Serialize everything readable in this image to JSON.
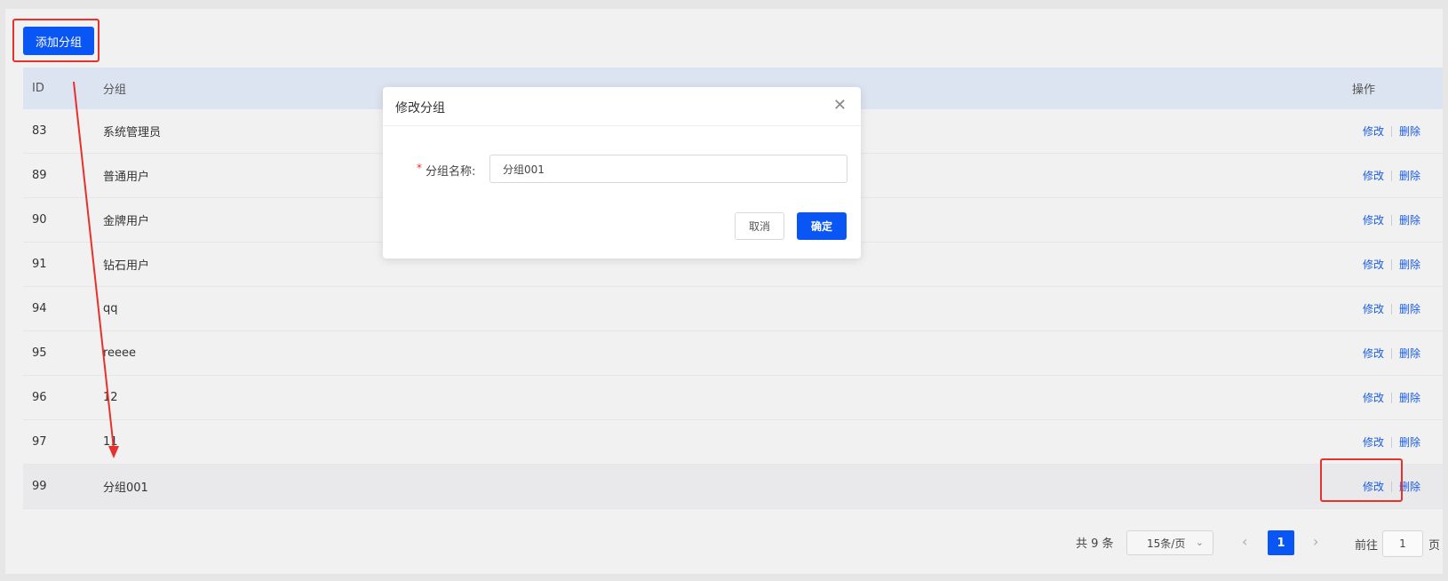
{
  "toolbar": {
    "add_group_label": "添加分组"
  },
  "table": {
    "headers": {
      "id": "ID",
      "name": "分组",
      "ops": "操作"
    },
    "rows": [
      {
        "id": "83",
        "name": "系统管理员"
      },
      {
        "id": "89",
        "name": "普通用户"
      },
      {
        "id": "90",
        "name": "金牌用户"
      },
      {
        "id": "91",
        "name": "钻石用户"
      },
      {
        "id": "94",
        "name": "qq"
      },
      {
        "id": "95",
        "name": "reeee"
      },
      {
        "id": "96",
        "name": "12"
      },
      {
        "id": "97",
        "name": "11"
      },
      {
        "id": "99",
        "name": "分组001"
      }
    ],
    "edit_label": "修改",
    "delete_label": "删除"
  },
  "pagination": {
    "total": "共 9 条",
    "page_size": "15条/页",
    "current_page": "1",
    "goto_prefix": "前往",
    "goto_value": "1",
    "goto_suffix": "页"
  },
  "dialog": {
    "title": "修改分组",
    "required_mark": "*",
    "field_label": "分组名称:",
    "field_value": "分组001",
    "cancel_label": "取消",
    "confirm_label": "确定"
  },
  "colors": {
    "primary": "#0a56f5",
    "highlight": "#e8302c",
    "header_bg": "#dce3f1"
  },
  "icons": {
    "close": "close-icon",
    "chevron": "chevron-down-icon",
    "prev": "chevron-left-icon",
    "next": "chevron-right-icon"
  }
}
